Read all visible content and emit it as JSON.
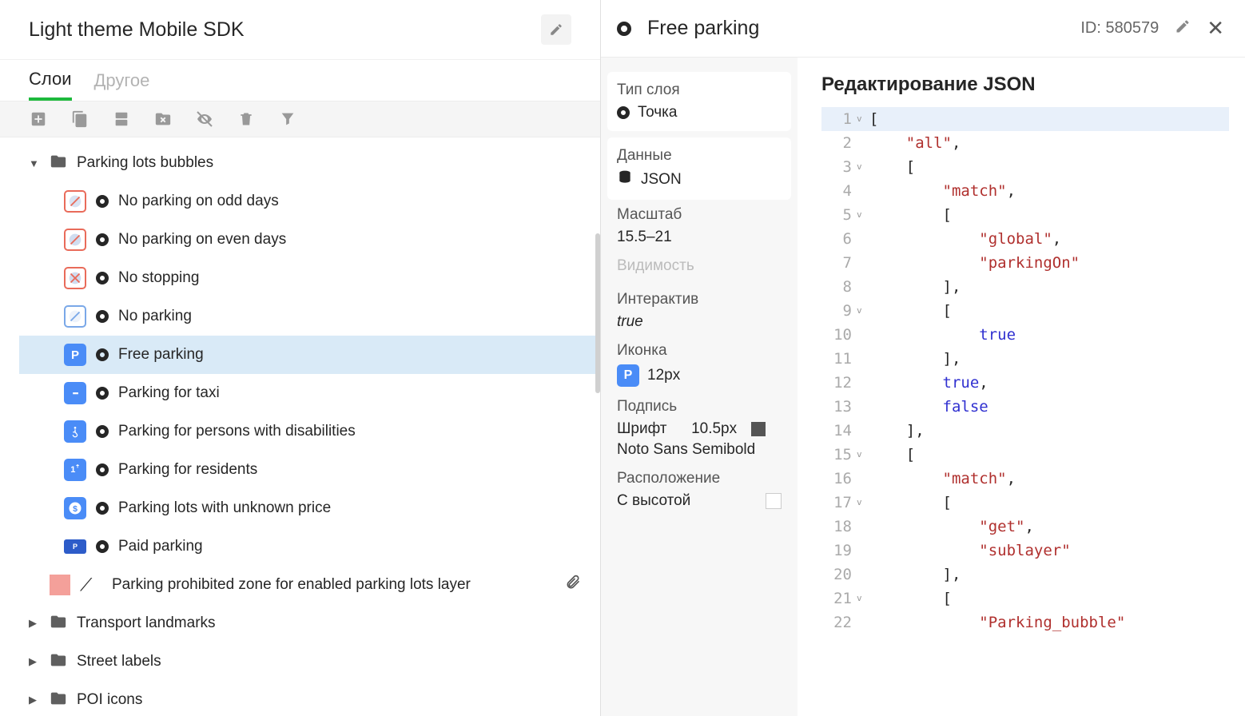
{
  "header": {
    "title": "Light theme Mobile SDK"
  },
  "tabs": {
    "layers": "Слои",
    "other": "Другое"
  },
  "tree": {
    "folder1": "Parking lots bubbles",
    "items": [
      "No parking on odd days",
      "No parking on even days",
      "No stopping",
      "No parking",
      "Free parking",
      "Parking for taxi",
      "Parking for persons with disabilities",
      "Parking for residents",
      "Parking lots with unknown price",
      "Paid parking"
    ],
    "prohibited": "Parking prohibited zone for enabled parking lots layer",
    "folder2": "Transport landmarks",
    "folder3": "Street labels",
    "folder4": "POI icons"
  },
  "detail": {
    "title": "Free parking",
    "id": "ID: 580579"
  },
  "props": {
    "layerType": {
      "label": "Тип слоя",
      "value": "Точка"
    },
    "dataSrc": {
      "label": "Данные",
      "value": "JSON"
    },
    "scale": {
      "label": "Масштаб",
      "value": "15.5–21"
    },
    "visibility": {
      "label": "Видимость"
    },
    "interactive": {
      "label": "Интерактив",
      "value": "true"
    },
    "icon": {
      "label": "Иконка",
      "value": "12px"
    },
    "caption": {
      "label": "Подпись",
      "font": "Шрифт",
      "size": "10.5px",
      "family": "Noto Sans Semibold"
    },
    "placement": {
      "label": "Расположение",
      "value": "С высотой"
    }
  },
  "json": {
    "title": "Редактирование JSON",
    "lines": [
      {
        "n": 1,
        "fold": "v",
        "parts": [
          [
            "[",
            "pun"
          ]
        ]
      },
      {
        "n": 2,
        "fold": "",
        "parts": [
          [
            "    ",
            ""
          ],
          [
            "\"all\"",
            "str"
          ],
          [
            ",",
            "pun"
          ]
        ]
      },
      {
        "n": 3,
        "fold": "v",
        "parts": [
          [
            "    ",
            ""
          ],
          [
            "[",
            "pun"
          ]
        ]
      },
      {
        "n": 4,
        "fold": "",
        "parts": [
          [
            "        ",
            ""
          ],
          [
            "\"match\"",
            "str"
          ],
          [
            ",",
            "pun"
          ]
        ]
      },
      {
        "n": 5,
        "fold": "v",
        "parts": [
          [
            "        ",
            ""
          ],
          [
            "[",
            "pun"
          ]
        ]
      },
      {
        "n": 6,
        "fold": "",
        "parts": [
          [
            "            ",
            ""
          ],
          [
            "\"global\"",
            "str"
          ],
          [
            ",",
            "pun"
          ]
        ]
      },
      {
        "n": 7,
        "fold": "",
        "parts": [
          [
            "            ",
            ""
          ],
          [
            "\"parkingOn\"",
            "str"
          ]
        ]
      },
      {
        "n": 8,
        "fold": "",
        "parts": [
          [
            "        ",
            ""
          ],
          [
            "],",
            "pun"
          ]
        ]
      },
      {
        "n": 9,
        "fold": "v",
        "parts": [
          [
            "        ",
            ""
          ],
          [
            "[",
            "pun"
          ]
        ]
      },
      {
        "n": 10,
        "fold": "",
        "parts": [
          [
            "            ",
            ""
          ],
          [
            "true",
            "kw"
          ]
        ]
      },
      {
        "n": 11,
        "fold": "",
        "parts": [
          [
            "        ",
            ""
          ],
          [
            "],",
            "pun"
          ]
        ]
      },
      {
        "n": 12,
        "fold": "",
        "parts": [
          [
            "        ",
            ""
          ],
          [
            "true",
            "kw"
          ],
          [
            ",",
            "pun"
          ]
        ]
      },
      {
        "n": 13,
        "fold": "",
        "parts": [
          [
            "        ",
            ""
          ],
          [
            "false",
            "kw"
          ]
        ]
      },
      {
        "n": 14,
        "fold": "",
        "parts": [
          [
            "    ",
            ""
          ],
          [
            "],",
            "pun"
          ]
        ]
      },
      {
        "n": 15,
        "fold": "v",
        "parts": [
          [
            "    ",
            ""
          ],
          [
            "[",
            "pun"
          ]
        ]
      },
      {
        "n": 16,
        "fold": "",
        "parts": [
          [
            "        ",
            ""
          ],
          [
            "\"match\"",
            "str"
          ],
          [
            ",",
            "pun"
          ]
        ]
      },
      {
        "n": 17,
        "fold": "v",
        "parts": [
          [
            "        ",
            ""
          ],
          [
            "[",
            "pun"
          ]
        ]
      },
      {
        "n": 18,
        "fold": "",
        "parts": [
          [
            "            ",
            ""
          ],
          [
            "\"get\"",
            "str"
          ],
          [
            ",",
            "pun"
          ]
        ]
      },
      {
        "n": 19,
        "fold": "",
        "parts": [
          [
            "            ",
            ""
          ],
          [
            "\"sublayer\"",
            "str"
          ]
        ]
      },
      {
        "n": 20,
        "fold": "",
        "parts": [
          [
            "        ",
            ""
          ],
          [
            "],",
            "pun"
          ]
        ]
      },
      {
        "n": 21,
        "fold": "v",
        "parts": [
          [
            "        ",
            ""
          ],
          [
            "[",
            "pun"
          ]
        ]
      },
      {
        "n": 22,
        "fold": "",
        "parts": [
          [
            "            ",
            ""
          ],
          [
            "\"Parking_bubble\"",
            "str"
          ]
        ]
      }
    ]
  }
}
